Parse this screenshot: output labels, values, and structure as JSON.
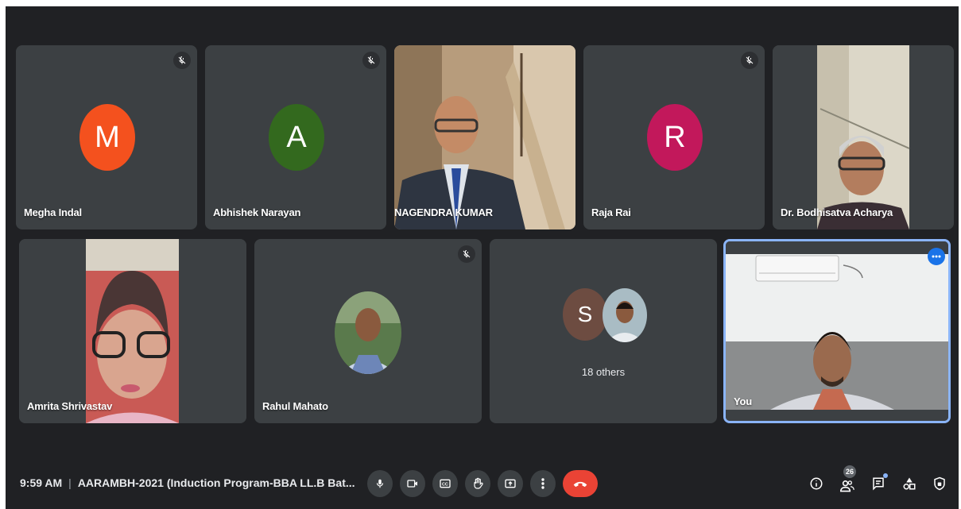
{
  "participants": [
    {
      "name": "Megha Indal",
      "initial": "M",
      "color": "#f4511e",
      "muted": true
    },
    {
      "name": "Abhishek Narayan",
      "initial": "A",
      "color": "#33691e",
      "muted": true
    },
    {
      "name": "NAGENDRA KUMAR",
      "muted": false
    },
    {
      "name": "Raja Rai",
      "initial": "R",
      "color": "#c2185b",
      "muted": true
    },
    {
      "name": "Dr. Bodhisatva Acharya",
      "muted": false
    },
    {
      "name": "Amrita Shrivastav",
      "muted": false
    },
    {
      "name": "Rahul Mahato",
      "muted": true
    },
    {
      "name": "18 others",
      "initial": "S",
      "color": "#6d4c41"
    },
    {
      "name": "You"
    }
  ],
  "bottom": {
    "time": "9:59 AM",
    "separator": "|",
    "meeting_title": "AARAMBH-2021 (Induction Program-BBA LL.B Bat...",
    "controls": [
      "mic-icon",
      "camera-icon",
      "captions-icon",
      "raise-hand-icon",
      "present-icon",
      "more-options-icon",
      "end-call-icon"
    ],
    "right_icons": [
      "info-icon",
      "people-icon",
      "chat-icon",
      "activities-icon",
      "host-controls-icon"
    ],
    "people_count": "26"
  },
  "colors": {
    "background": "#202124",
    "tile": "#3c4043",
    "end_call": "#ea4335",
    "active_border": "#8ab4f8"
  }
}
